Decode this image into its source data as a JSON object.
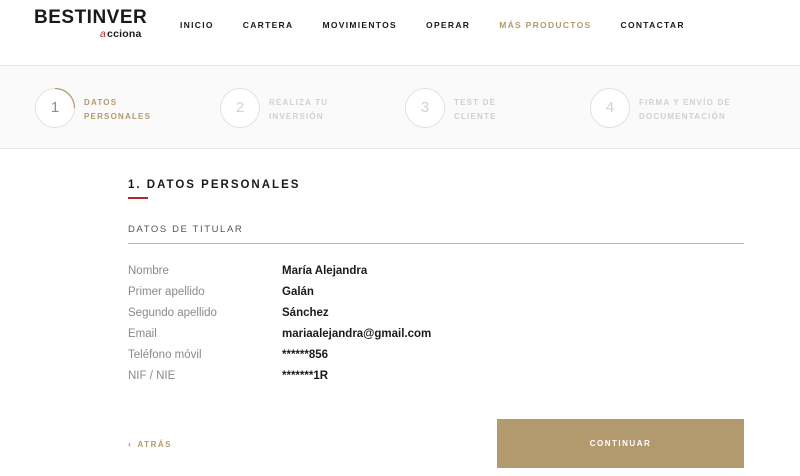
{
  "brand": {
    "name": "BESTINVER",
    "sub_mark": "a",
    "sub": "cciona"
  },
  "nav": [
    {
      "label": "INICIO",
      "active": false
    },
    {
      "label": "CARTERA",
      "active": false
    },
    {
      "label": "MOVIMIENTOS",
      "active": false
    },
    {
      "label": "OPERAR",
      "active": false
    },
    {
      "label": "MÁS PRODUCTOS",
      "active": true
    },
    {
      "label": "CONTACTAR",
      "active": false
    }
  ],
  "steps": [
    {
      "number": "1",
      "line1": "DATOS",
      "line2": "PERSONALES",
      "active": true
    },
    {
      "number": "2",
      "line1": "REALIZA TU",
      "line2": "INVERSIÓN",
      "active": false
    },
    {
      "number": "3",
      "line1": "TEST DE",
      "line2": "CLIENTE",
      "active": false
    },
    {
      "number": "4",
      "line1": "FIRMA Y ENVÍO DE",
      "line2": "DOCUMENTACIÓN",
      "active": false
    }
  ],
  "section": {
    "title": "1. DATOS PERSONALES",
    "subtitle": "DATOS DE TITULAR"
  },
  "details": [
    {
      "label": "Nombre",
      "value": "María Alejandra"
    },
    {
      "label": "Primer apellido",
      "value": "Galán"
    },
    {
      "label": "Segundo apellido",
      "value": "Sánchez"
    },
    {
      "label": "Email",
      "value": "mariaalejandra@gmail.com"
    },
    {
      "label": "Teléfono móvil",
      "value": "******856"
    },
    {
      "label": "NIF / NIE",
      "value": "*******1R"
    }
  ],
  "actions": {
    "back_label": "ATRÁS",
    "back_icon": "chevron-left-icon",
    "continue_label": "CONTINUAR"
  },
  "colors": {
    "accent_gold": "#b3996e",
    "brand_red": "#b3282d",
    "text_dark": "#1a1a1a",
    "text_muted": "#8a8a8a",
    "step_inactive": "#d0d0d0"
  }
}
